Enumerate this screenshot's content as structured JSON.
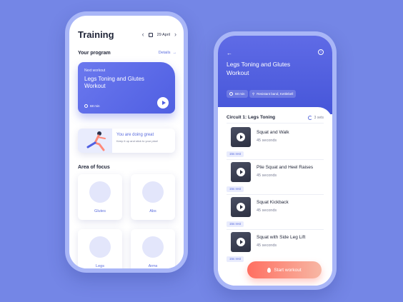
{
  "left_screen": {
    "title": "Training",
    "date": "29 April",
    "section_program": "Your program",
    "details": "Details",
    "next_label": "Next workout",
    "workout_title": "Legs Toning and Glutes Workout",
    "duration": "68 min",
    "motivation_title": "You are doing great",
    "motivation_text": "Keep it up and stick to your plan!",
    "section_focus": "Area of focus",
    "focus": [
      "Glutes",
      "Abs",
      "Legs",
      "Arms"
    ]
  },
  "right_screen": {
    "title": "Legs Toning and Glutes Workout",
    "duration": "68 min",
    "equipment": "Resistant band, Kettlebell",
    "circuit": "Circuit 1: Legs Toning",
    "sets": "3 sets",
    "rest": "15s rest",
    "exercises": [
      {
        "name": "Squat and Walk",
        "time": "45 seconds"
      },
      {
        "name": "Plie Squat and Heel Raises",
        "time": "45 seconds"
      },
      {
        "name": "Squat Kickback",
        "time": "45 seconds"
      },
      {
        "name": "Squat with Side Leg Lift",
        "time": "45 seconds"
      }
    ],
    "start_button": "Start workout"
  },
  "icons": [
    "chevron-left-icon",
    "chevron-right-icon",
    "calendar-icon",
    "arrow-right-icon",
    "clock-icon",
    "play-icon",
    "back-arrow-icon",
    "info-icon",
    "kettlebell-icon",
    "refresh-icon",
    "flame-icon"
  ],
  "colors": {
    "background": "#7486e6",
    "accent": "#5b6dde",
    "start": "#ff6f61"
  }
}
